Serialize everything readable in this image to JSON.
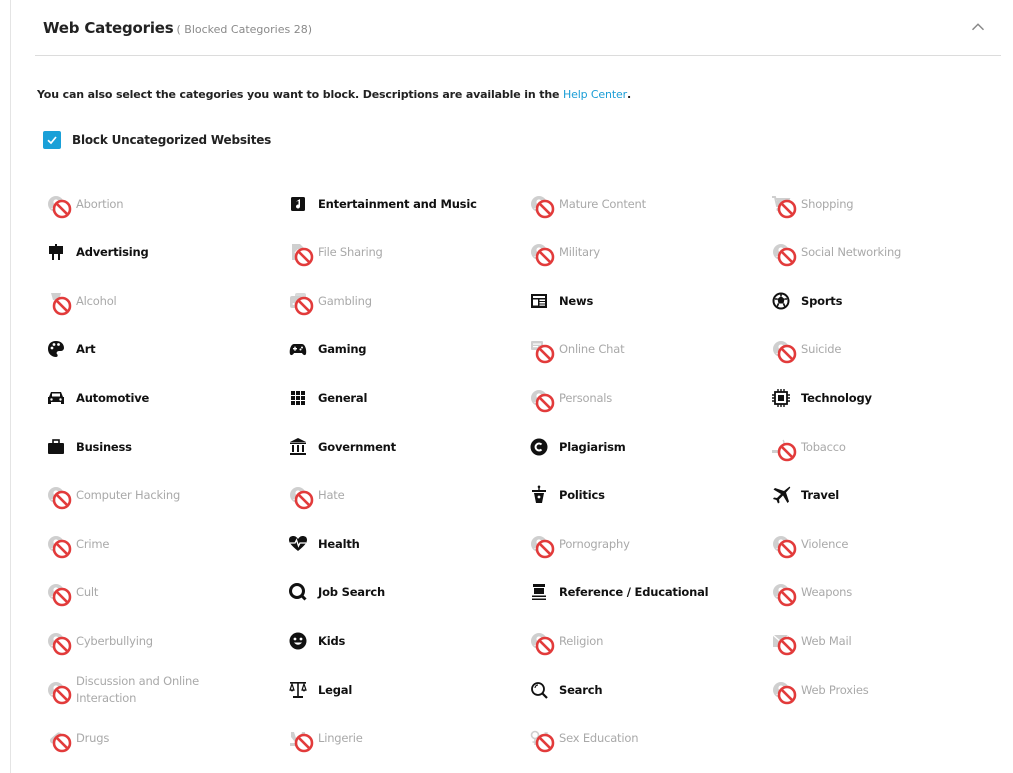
{
  "header": {
    "title": "Web Categories",
    "subtitle": "( Blocked Categories 28)"
  },
  "intro": {
    "text": "You can also select the categories you want to block. Descriptions are available in the ",
    "link": "Help Center",
    "suffix": "."
  },
  "block_uncategorized": {
    "label": "Block Uncategorized Websites",
    "checked": true
  },
  "colors": {
    "accent": "#1aa0d8",
    "disabled_text": "#a9a9a9",
    "ban_red": "#e23b3b"
  },
  "columns": [
    [
      {
        "label": "Abortion",
        "allowed": false,
        "icon": "abortion-icon"
      },
      {
        "label": "Advertising",
        "allowed": true,
        "icon": "billboard-icon"
      },
      {
        "label": "Alcohol",
        "allowed": false,
        "icon": "glass-icon"
      },
      {
        "label": "Art",
        "allowed": true,
        "icon": "palette-icon"
      },
      {
        "label": "Automotive",
        "allowed": true,
        "icon": "car-icon"
      },
      {
        "label": "Business",
        "allowed": true,
        "icon": "briefcase-icon"
      },
      {
        "label": "Computer Hacking",
        "allowed": false,
        "icon": "hacker-icon"
      },
      {
        "label": "Crime",
        "allowed": false,
        "icon": "crime-icon"
      },
      {
        "label": "Cult",
        "allowed": false,
        "icon": "cult-icon"
      },
      {
        "label": "Cyberbullying",
        "allowed": false,
        "icon": "cyberbullying-icon"
      },
      {
        "label": "Discussion and Online Interaction",
        "allowed": false,
        "icon": "discussion-icon"
      },
      {
        "label": "Drugs",
        "allowed": false,
        "icon": "pill-icon"
      }
    ],
    [
      {
        "label": "Entertainment and Music",
        "allowed": true,
        "icon": "music-icon"
      },
      {
        "label": "File Sharing",
        "allowed": false,
        "icon": "file-icon"
      },
      {
        "label": "Gambling",
        "allowed": false,
        "icon": "dice-icon"
      },
      {
        "label": "Gaming",
        "allowed": true,
        "icon": "gamepad-icon"
      },
      {
        "label": "General",
        "allowed": true,
        "icon": "grid-icon"
      },
      {
        "label": "Government",
        "allowed": true,
        "icon": "government-building-icon"
      },
      {
        "label": "Hate",
        "allowed": false,
        "icon": "hate-icon"
      },
      {
        "label": "Health",
        "allowed": true,
        "icon": "heartbeat-icon"
      },
      {
        "label": "Job Search",
        "allowed": true,
        "icon": "job-search-icon"
      },
      {
        "label": "Kids",
        "allowed": true,
        "icon": "smiley-icon"
      },
      {
        "label": "Legal",
        "allowed": true,
        "icon": "scales-icon"
      },
      {
        "label": "Lingerie",
        "allowed": false,
        "icon": "lingerie-icon"
      }
    ],
    [
      {
        "label": "Mature Content",
        "allowed": false,
        "icon": "mature-icon"
      },
      {
        "label": "Military",
        "allowed": false,
        "icon": "military-icon"
      },
      {
        "label": "News",
        "allowed": true,
        "icon": "newspaper-icon"
      },
      {
        "label": "Online Chat",
        "allowed": false,
        "icon": "chat-icon"
      },
      {
        "label": "Personals",
        "allowed": false,
        "icon": "personals-icon"
      },
      {
        "label": "Plagiarism",
        "allowed": true,
        "icon": "copyright-icon"
      },
      {
        "label": "Politics",
        "allowed": true,
        "icon": "podium-icon"
      },
      {
        "label": "Pornography",
        "allowed": false,
        "icon": "pornography-icon"
      },
      {
        "label": "Reference / Educational",
        "allowed": true,
        "icon": "graduation-icon"
      },
      {
        "label": "Religion",
        "allowed": false,
        "icon": "religion-icon"
      },
      {
        "label": "Search",
        "allowed": true,
        "icon": "search-icon"
      },
      {
        "label": "Sex Education",
        "allowed": false,
        "icon": "gender-icon"
      }
    ],
    [
      {
        "label": "Shopping",
        "allowed": false,
        "icon": "cart-icon"
      },
      {
        "label": "Social Networking",
        "allowed": false,
        "icon": "social-icon"
      },
      {
        "label": "Sports",
        "allowed": true,
        "icon": "soccer-ball-icon"
      },
      {
        "label": "Suicide",
        "allowed": false,
        "icon": "suicide-icon"
      },
      {
        "label": "Technology",
        "allowed": true,
        "icon": "chip-icon"
      },
      {
        "label": "Tobacco",
        "allowed": false,
        "icon": "cigarette-icon"
      },
      {
        "label": "Travel",
        "allowed": true,
        "icon": "airplane-icon"
      },
      {
        "label": "Violence",
        "allowed": false,
        "icon": "violence-icon"
      },
      {
        "label": "Weapons",
        "allowed": false,
        "icon": "weapons-icon"
      },
      {
        "label": "Web Mail",
        "allowed": false,
        "icon": "mail-icon"
      },
      {
        "label": "Web Proxies",
        "allowed": false,
        "icon": "proxy-icon"
      }
    ]
  ]
}
